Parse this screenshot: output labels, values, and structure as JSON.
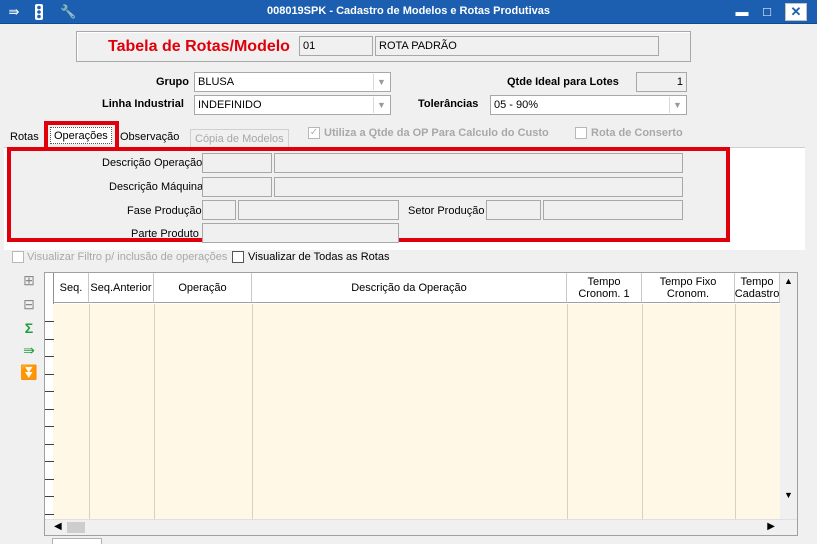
{
  "window": {
    "title": "008019SPK - Cadastro de Modelos e Rotas Produtivas",
    "minimize": "▬",
    "maximize": "□",
    "close": "✕"
  },
  "header": {
    "label": "Tabela de Rotas/Modelo",
    "code": "01",
    "name": "ROTA PADRÃO",
    "label_color": "#e0000b"
  },
  "form": {
    "grupo_label": "Grupo",
    "grupo_value": "BLUSA",
    "linha_label": "Linha Industrial",
    "linha_value": "INDEFINIDO",
    "qtde_label": "Qtde Ideal para Lotes",
    "qtde_value": "1",
    "toler_label": "Tolerâncias",
    "toler_value": "05 - 90%"
  },
  "tabs": [
    {
      "label": "Rotas"
    },
    {
      "label": "Operações"
    },
    {
      "label": "Observação"
    },
    {
      "label": "Cópia de Modelos"
    }
  ],
  "options": {
    "utiliza_qtde": "Utiliza a Qtde da OP Para Calculo do Custo",
    "rota_conserto": "Rota de Conserto"
  },
  "filter": {
    "descricao_operacao": "Descrição Operação",
    "descricao_maquina": "Descrição Máquina",
    "fase_producao": "Fase Produção",
    "setor_producao": "Setor Produção",
    "parte_produto": "Parte Produto"
  },
  "checks": {
    "visualizar_filtro": "Visualizar Filtro p/ inclusão de operações",
    "visualizar_todas": "Visualizar de Todas as Rotas"
  },
  "grid": {
    "columns": [
      "Seq.",
      "Seq.Anterior",
      "Operação",
      "Descrição da Operação",
      "Tempo Cronom. 1",
      "Tempo Fixo Cronom.",
      "Tempo Cadastro"
    ]
  },
  "colors": {
    "titlebar": "#1c5fb0",
    "highlight": "#e0000b",
    "grid_body": "#fff8e6"
  }
}
